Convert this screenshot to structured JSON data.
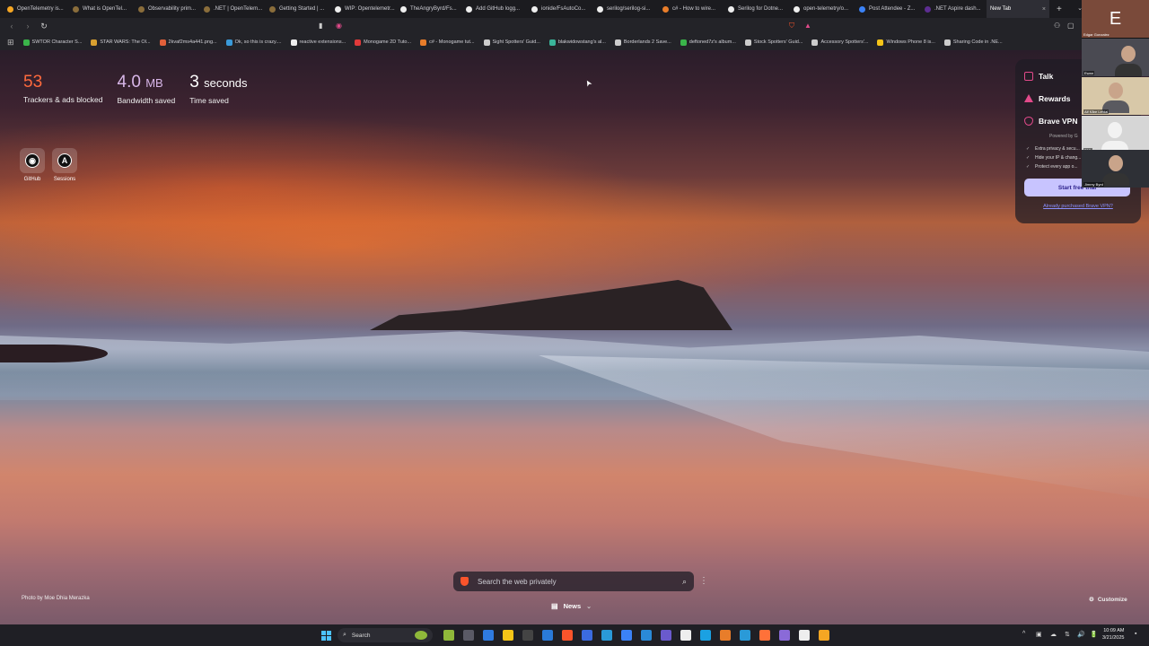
{
  "tabs": [
    {
      "label": "OpenTelemetry is...",
      "color": "#f5a623"
    },
    {
      "label": "What is OpenTel...",
      "color": "#8a6d3b"
    },
    {
      "label": "Observability prim...",
      "color": "#8a6d3b"
    },
    {
      "label": ".NET | OpenTelem...",
      "color": "#8a6d3b"
    },
    {
      "label": "Getting Started | ...",
      "color": "#8a6d3b"
    },
    {
      "label": "WIP: Opentelemetr...",
      "color": "#eeeeee"
    },
    {
      "label": "TheAngryByrd/Fs...",
      "color": "#eeeeee"
    },
    {
      "label": "Add GitHub logg...",
      "color": "#eeeeee"
    },
    {
      "label": "ionide/FsAutoCo...",
      "color": "#eeeeee"
    },
    {
      "label": "serilog/serilog-si...",
      "color": "#eeeeee"
    },
    {
      "label": "c# - How to wire...",
      "color": "#e87d2a"
    },
    {
      "label": "Serilog for Dotne...",
      "color": "#eeeeee"
    },
    {
      "label": "open-telemetry/o...",
      "color": "#eeeeee"
    },
    {
      "label": "Post Attendee - Z...",
      "color": "#3b82f6"
    },
    {
      "label": ".NET Aspire dash...",
      "color": "#5c2d91"
    }
  ],
  "active_tab": {
    "label": "New Tab",
    "close": "×"
  },
  "new_tab_glyph": "+",
  "tab_menu_glyph": "⌄",
  "toolbar": {
    "back": "‹",
    "forward": "›",
    "reload": "↻"
  },
  "bookmarks": [
    {
      "label": "SWTOR Character S...",
      "color": "#3ab54a"
    },
    {
      "label": "STAR WARS: The Ol...",
      "color": "#d8a030"
    },
    {
      "label": "2kvaf2ms4a441.png...",
      "color": "#e0603a"
    },
    {
      "label": "Ok, so this is crazy....",
      "color": "#3a9ad8"
    },
    {
      "label": "reactive extensions...",
      "color": "#eeeeee"
    },
    {
      "label": "Monogame 2D Tuto...",
      "color": "#e03a3a"
    },
    {
      "label": "c# - Monogame tut...",
      "color": "#e87d2a"
    },
    {
      "label": "Sight Spotters' Guid...",
      "color": "#cccccc"
    },
    {
      "label": "blakwidowstang's al...",
      "color": "#3ab59a"
    },
    {
      "label": "Borderlands 2 Save...",
      "color": "#cccccc"
    },
    {
      "label": "deftoned7z's album...",
      "color": "#3ab54a"
    },
    {
      "label": "Stock Spotters' Guid...",
      "color": "#cccccc"
    },
    {
      "label": "Accessory Spotters'...",
      "color": "#cccccc"
    },
    {
      "label": "Windows Phone 8 is...",
      "color": "#f5c518"
    },
    {
      "label": "Sharing Code in .NE...",
      "color": "#cccccc"
    }
  ],
  "stats": {
    "trackers": {
      "value": "53",
      "label": "Trackers & ads blocked"
    },
    "bandwidth": {
      "value": "4.0",
      "unit": "MB",
      "label": "Bandwidth saved"
    },
    "time": {
      "value": "3",
      "unit": "seconds",
      "label": "Time saved"
    }
  },
  "top_sites": [
    {
      "label": "GitHub",
      "glyph": "◉"
    },
    {
      "label": "Sessions",
      "glyph": "A"
    }
  ],
  "side_panel": {
    "talk": "Talk",
    "rewards": "Rewards",
    "vpn": "Brave VPN",
    "powered_by": "Powered by G",
    "features": [
      "Extra privacy & secu...",
      "Hide your IP & chang...",
      "Protect every app o..."
    ],
    "cta": "Start free trial",
    "already_link": "Already purchased Brave VPN?"
  },
  "participants": {
    "e_letter": "E",
    "e_name": "Edgar Gonzalez",
    "p1": "Ewan",
    "p2": "Alf Kåre Lefdal",
    "p3": "DML",
    "p4": "Jimmy Byrd"
  },
  "search": {
    "placeholder": "Search the web privately",
    "mag": "⌕",
    "more": "⋮"
  },
  "news": {
    "label": "News",
    "icon": "▤",
    "chevron": "⌄"
  },
  "photo_credit": "Photo by Moe Dhia Merazka",
  "customize": {
    "label": "Customize",
    "icon": "⚙"
  },
  "cursor": "➤",
  "taskbar": {
    "search_label": "Search",
    "search_glyph": "⌕",
    "tray_glyphs": [
      "^",
      "▣",
      "☁",
      "⇅",
      "🔊",
      "🔋"
    ],
    "time": "10:09 AM",
    "date": "3/21/2025"
  },
  "colors": {
    "brave_orange": "#fb542b",
    "accent_purple": "#c8c4ff",
    "link": "#8a8fff"
  }
}
